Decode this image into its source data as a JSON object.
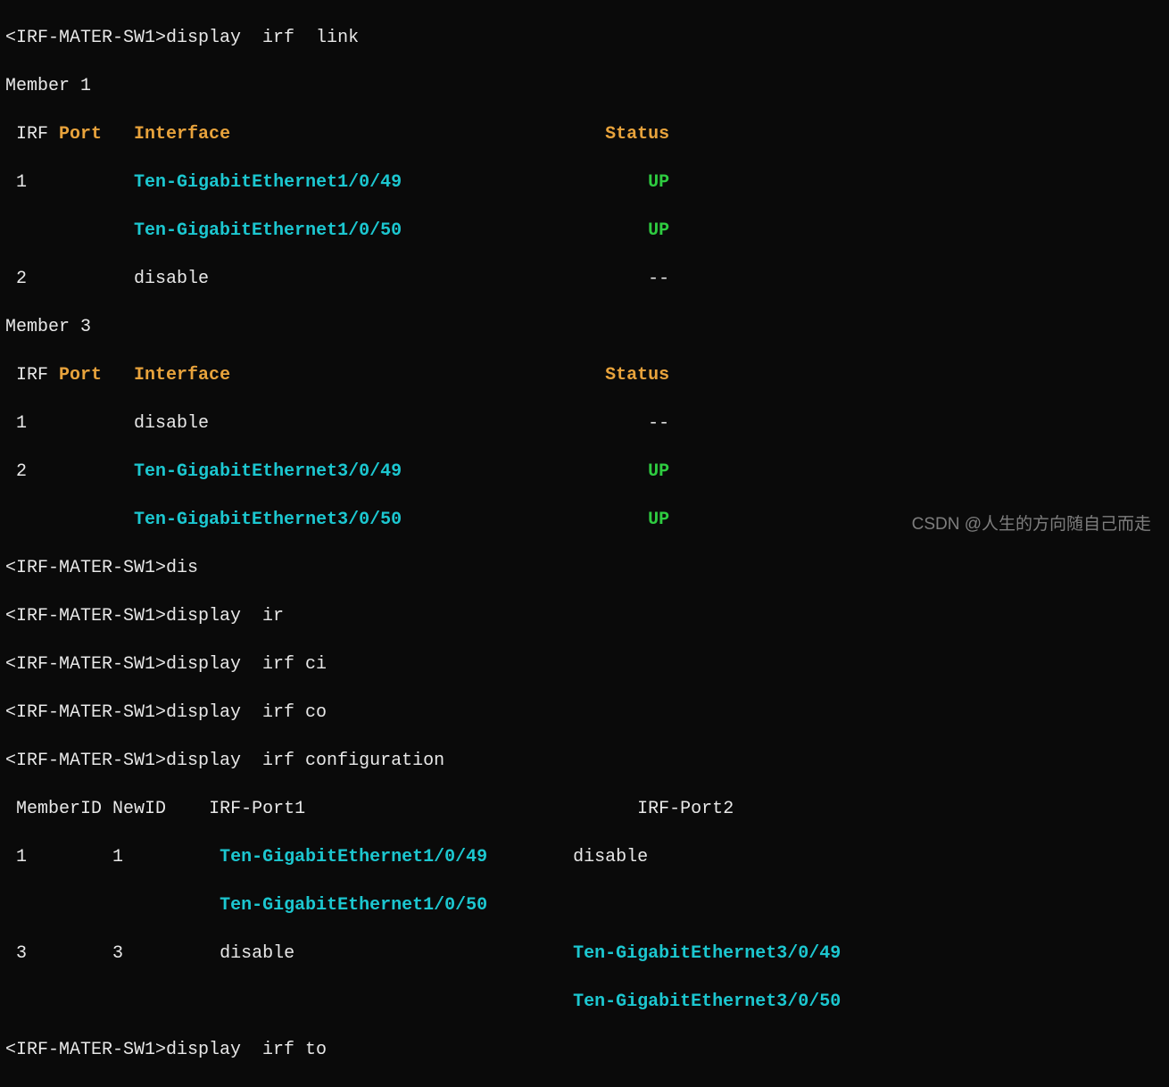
{
  "prompt": "<IRF-MATER-SW1>",
  "lines": {
    "cmd_display_irf_link": "display  irf  link",
    "member1": "Member 1",
    "member3": "Member 3",
    "hdr_irf": " IRF ",
    "hdr_port": "Port",
    "hdr_interface": "Interface",
    "hdr_status": "Status",
    "port1": " 1",
    "port2": " 2",
    "iface_1_49": "Ten-GigabitEthernet1/0/49",
    "iface_1_50": "Ten-GigabitEthernet1/0/50",
    "iface_3_49": "Ten-GigabitEthernet3/0/49",
    "iface_3_50": "Ten-GigabitEthernet3/0/50",
    "disable": "disable",
    "up": "UP",
    "dashes": "--",
    "cmd_dis": "dis",
    "cmd_display_ir": "display  ir",
    "cmd_display_irf_ci": "display  irf ci",
    "cmd_display_irf_co": "display  irf co",
    "cmd_display_irf_configuration": "display  irf configuration",
    "cfg_hdr_memberid": " MemberID",
    "cfg_hdr_newid": "NewID",
    "cfg_hdr_irfport1": "IRF-Port1",
    "cfg_hdr_irfport2": "IRF-Port2",
    "cfg_m1": " 1",
    "cfg_n1": "1",
    "cfg_m3": " 3",
    "cfg_n3": "3",
    "cmd_display_irf_to": "display  irf to"
  },
  "spacing": {
    "sp2": "  ",
    "sp3": "   ",
    "sp4": "    ",
    "sp8": "        ",
    "sp9": "         ",
    "sp10": "          ",
    "sp12": "            ",
    "sp13": "             ",
    "sp23": "                       ",
    "sp24": "                        ",
    "sp31": "                               ",
    "sp35": "                                   ",
    "sp58": "                                                          "
  },
  "watermark": "CSDN @人生的方向随自己而走"
}
